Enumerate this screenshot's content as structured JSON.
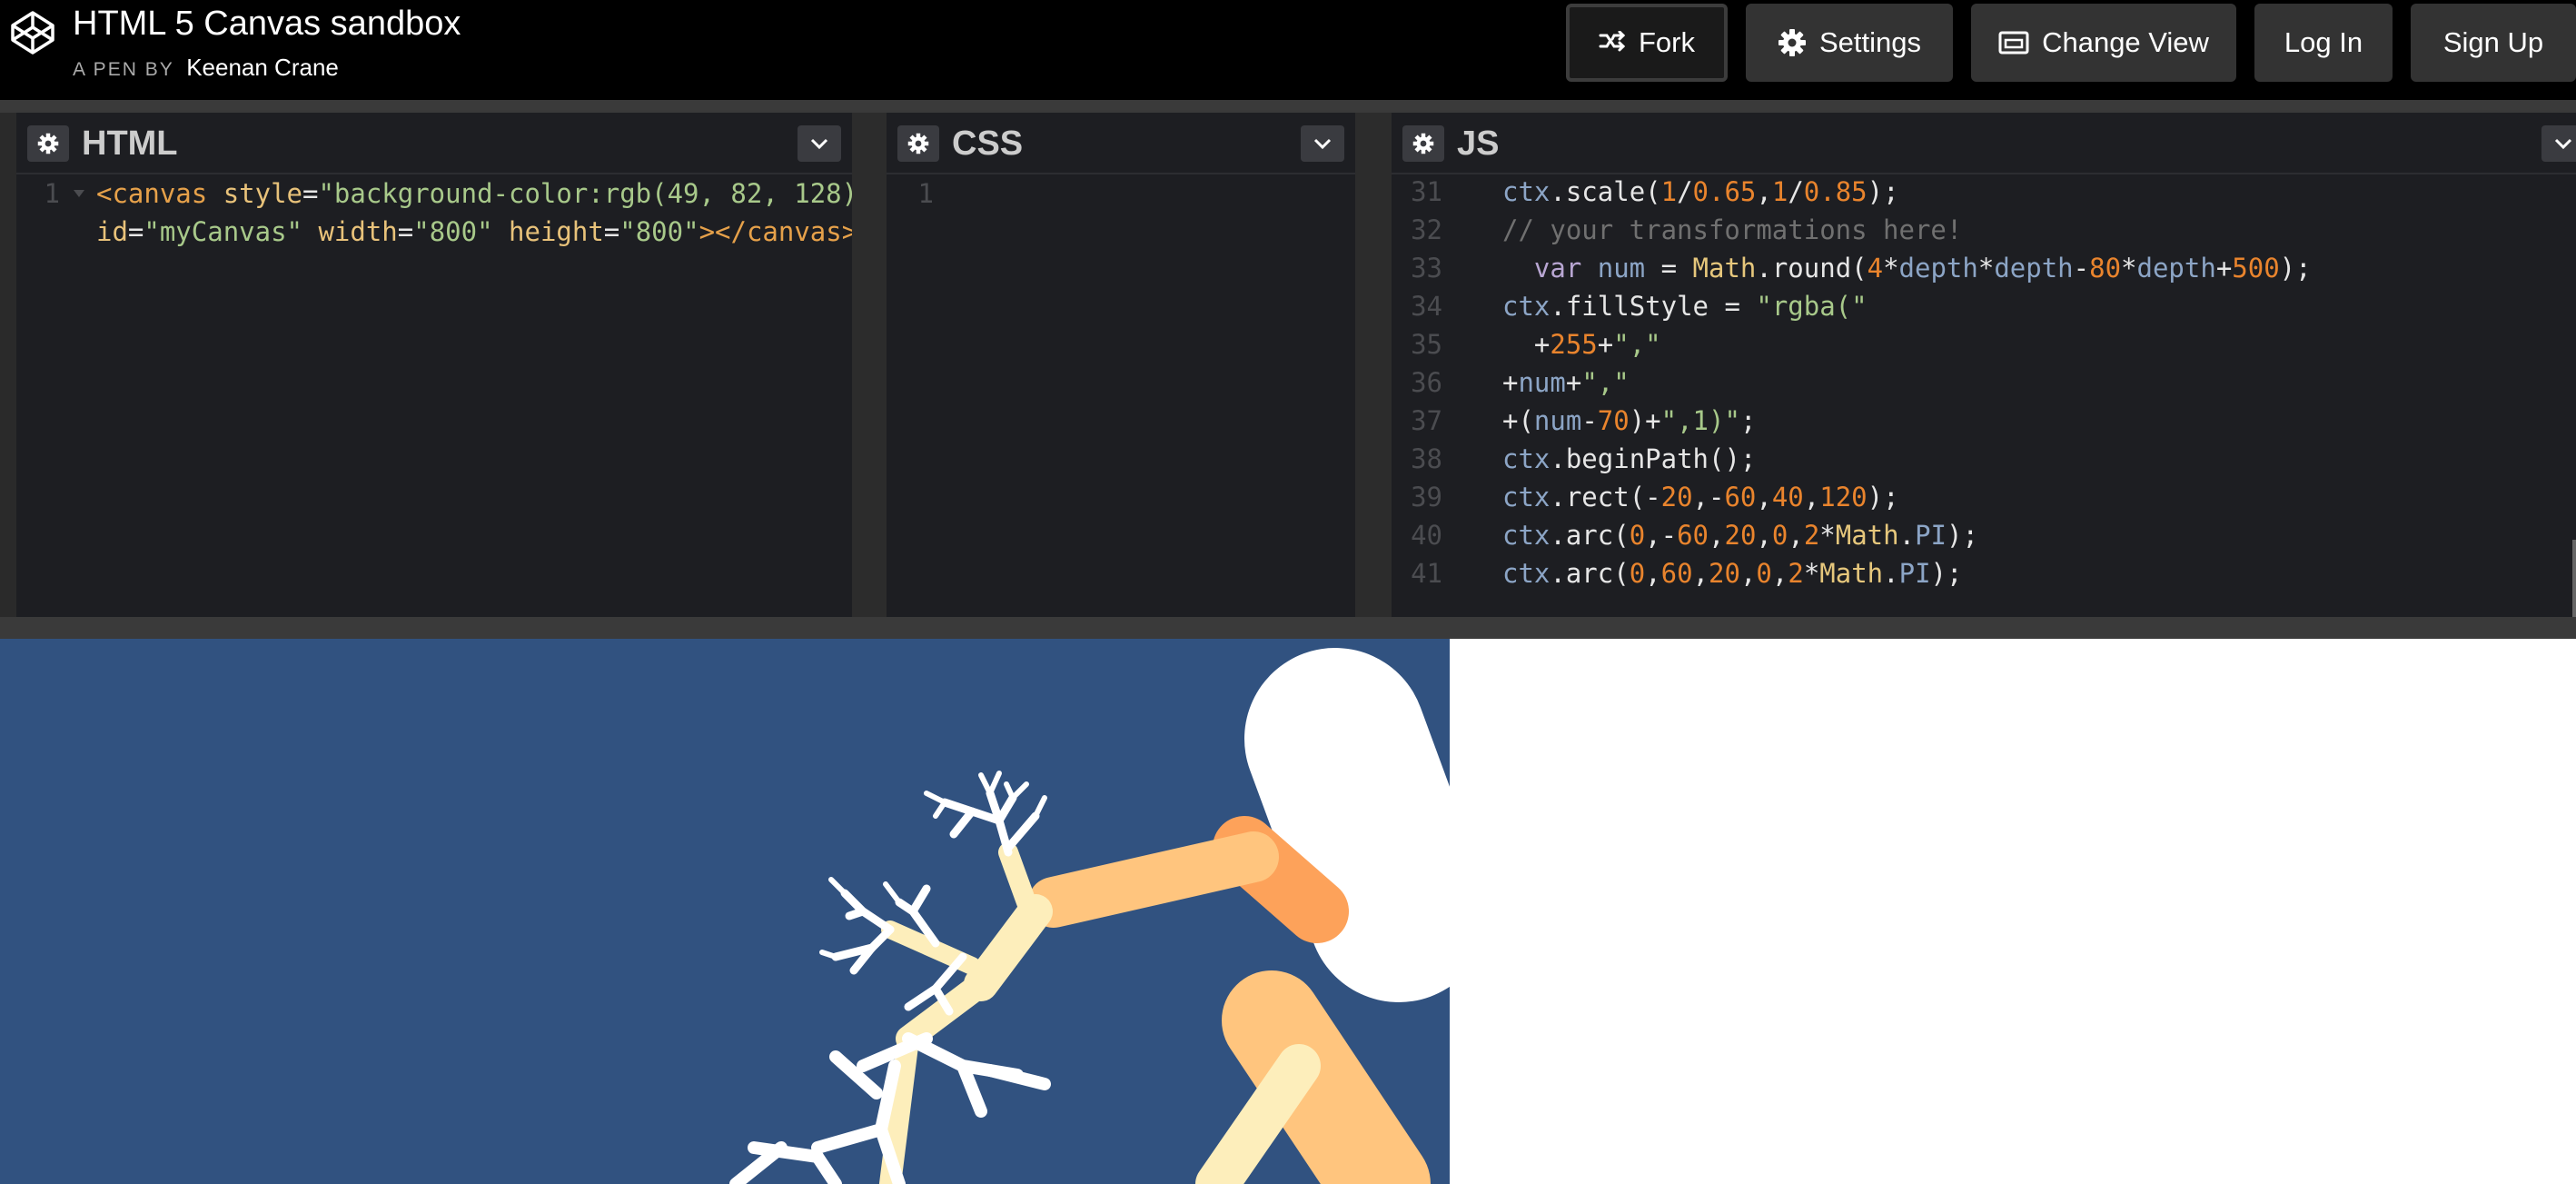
{
  "header": {
    "title": "HTML 5 Canvas sandbox",
    "byline_prefix": "A PEN BY",
    "author": "Keenan Crane",
    "buttons": {
      "fork": "Fork",
      "settings": "Settings",
      "change_view": "Change View",
      "login": "Log In",
      "signup": "Sign Up"
    }
  },
  "panes": {
    "html": {
      "title": "HTML"
    },
    "css": {
      "title": "CSS",
      "line_number": "1"
    },
    "js": {
      "title": "JS"
    }
  },
  "html_code": {
    "line_number": "1",
    "line1": [
      {
        "t": "<canvas ",
        "c": "tag"
      },
      {
        "t": "style",
        "c": "attr"
      },
      {
        "t": "=",
        "c": "pl"
      },
      {
        "t": "\"background-color:rgb(49, 82, 128)\"",
        "c": "str"
      }
    ],
    "line2": [
      {
        "t": "id",
        "c": "attr"
      },
      {
        "t": "=",
        "c": "pl"
      },
      {
        "t": "\"myCanvas\"",
        "c": "str"
      },
      {
        "t": " ",
        "c": "pl"
      },
      {
        "t": "width",
        "c": "attr"
      },
      {
        "t": "=",
        "c": "pl"
      },
      {
        "t": "\"800\"",
        "c": "str"
      },
      {
        "t": " ",
        "c": "pl"
      },
      {
        "t": "height",
        "c": "attr"
      },
      {
        "t": "=",
        "c": "pl"
      },
      {
        "t": "\"800\"",
        "c": "str"
      },
      {
        "t": "></canvas>",
        "c": "tag"
      }
    ]
  },
  "js_code": [
    {
      "n": "31",
      "indent": "",
      "toks": [
        {
          "t": "ctx",
          "c": "prop"
        },
        {
          "t": ".scale(",
          "c": "pl"
        },
        {
          "t": "1",
          "c": "num"
        },
        {
          "t": "/",
          "c": "pl"
        },
        {
          "t": "0.65",
          "c": "num"
        },
        {
          "t": ",",
          "c": "pl"
        },
        {
          "t": "1",
          "c": "num"
        },
        {
          "t": "/",
          "c": "pl"
        },
        {
          "t": "0.85",
          "c": "num"
        },
        {
          "t": ");",
          "c": "pl"
        }
      ]
    },
    {
      "n": "32",
      "indent": "",
      "toks": [
        {
          "t": "// your transformations here!",
          "c": "cm"
        }
      ]
    },
    {
      "n": "33",
      "indent": "  ",
      "toks": [
        {
          "t": "var ",
          "c": "kw"
        },
        {
          "t": "num",
          "c": "prop"
        },
        {
          "t": " = ",
          "c": "pl"
        },
        {
          "t": "Math",
          "c": "fn"
        },
        {
          "t": ".round(",
          "c": "pl"
        },
        {
          "t": "4",
          "c": "num"
        },
        {
          "t": "*",
          "c": "pl"
        },
        {
          "t": "depth",
          "c": "prop"
        },
        {
          "t": "*",
          "c": "pl"
        },
        {
          "t": "depth",
          "c": "prop"
        },
        {
          "t": "-",
          "c": "pl"
        },
        {
          "t": "80",
          "c": "num"
        },
        {
          "t": "*",
          "c": "pl"
        },
        {
          "t": "depth",
          "c": "prop"
        },
        {
          "t": "+",
          "c": "pl"
        },
        {
          "t": "500",
          "c": "num"
        },
        {
          "t": ");",
          "c": "pl"
        }
      ]
    },
    {
      "n": "34",
      "indent": "",
      "toks": [
        {
          "t": "ctx",
          "c": "prop"
        },
        {
          "t": ".fillStyle = ",
          "c": "pl"
        },
        {
          "t": "\"rgba(\"",
          "c": "str"
        }
      ]
    },
    {
      "n": "35",
      "indent": "  ",
      "toks": [
        {
          "t": "+",
          "c": "pl"
        },
        {
          "t": "255",
          "c": "num"
        },
        {
          "t": "+",
          "c": "pl"
        },
        {
          "t": "\",\"",
          "c": "str"
        }
      ]
    },
    {
      "n": "36",
      "indent": "",
      "toks": [
        {
          "t": "+",
          "c": "pl"
        },
        {
          "t": "num",
          "c": "prop"
        },
        {
          "t": "+",
          "c": "pl"
        },
        {
          "t": "\",\"",
          "c": "str"
        }
      ]
    },
    {
      "n": "37",
      "indent": "",
      "toks": [
        {
          "t": "+(",
          "c": "pl"
        },
        {
          "t": "num",
          "c": "prop"
        },
        {
          "t": "-",
          "c": "pl"
        },
        {
          "t": "70",
          "c": "num"
        },
        {
          "t": ")+",
          "c": "pl"
        },
        {
          "t": "\",1)\"",
          "c": "str"
        },
        {
          "t": ";",
          "c": "pl"
        }
      ]
    },
    {
      "n": "38",
      "indent": "",
      "toks": [
        {
          "t": "ctx",
          "c": "prop"
        },
        {
          "t": ".beginPath();",
          "c": "pl"
        }
      ]
    },
    {
      "n": "39",
      "indent": "",
      "toks": [
        {
          "t": "ctx",
          "c": "prop"
        },
        {
          "t": ".rect(-",
          "c": "pl"
        },
        {
          "t": "20",
          "c": "num"
        },
        {
          "t": ",-",
          "c": "pl"
        },
        {
          "t": "60",
          "c": "num"
        },
        {
          "t": ",",
          "c": "pl"
        },
        {
          "t": "40",
          "c": "num"
        },
        {
          "t": ",",
          "c": "pl"
        },
        {
          "t": "120",
          "c": "num"
        },
        {
          "t": ");",
          "c": "pl"
        }
      ]
    },
    {
      "n": "40",
      "indent": "",
      "toks": [
        {
          "t": "ctx",
          "c": "prop"
        },
        {
          "t": ".arc(",
          "c": "pl"
        },
        {
          "t": "0",
          "c": "num"
        },
        {
          "t": ",-",
          "c": "pl"
        },
        {
          "t": "60",
          "c": "num"
        },
        {
          "t": ",",
          "c": "pl"
        },
        {
          "t": "20",
          "c": "num"
        },
        {
          "t": ",",
          "c": "pl"
        },
        {
          "t": "0",
          "c": "num"
        },
        {
          "t": ",",
          "c": "pl"
        },
        {
          "t": "2",
          "c": "num"
        },
        {
          "t": "*",
          "c": "pl"
        },
        {
          "t": "Math",
          "c": "fn"
        },
        {
          "t": ".",
          "c": "pl"
        },
        {
          "t": "PI",
          "c": "prop"
        },
        {
          "t": ");",
          "c": "pl"
        }
      ]
    },
    {
      "n": "41",
      "indent": "",
      "toks": [
        {
          "t": "ctx",
          "c": "prop"
        },
        {
          "t": ".arc(",
          "c": "pl"
        },
        {
          "t": "0",
          "c": "num"
        },
        {
          "t": ",",
          "c": "pl"
        },
        {
          "t": "60",
          "c": "num"
        },
        {
          "t": ",",
          "c": "pl"
        },
        {
          "t": "20",
          "c": "num"
        },
        {
          "t": ",",
          "c": "pl"
        },
        {
          "t": "0",
          "c": "num"
        },
        {
          "t": ",",
          "c": "pl"
        },
        {
          "t": "2",
          "c": "num"
        },
        {
          "t": "*",
          "c": "pl"
        },
        {
          "t": "Math",
          "c": "fn"
        },
        {
          "t": ".",
          "c": "pl"
        },
        {
          "t": "PI",
          "c": "prop"
        },
        {
          "t": ");",
          "c": "pl"
        }
      ]
    }
  ],
  "colors": {
    "canvas_bg": "#315280",
    "branch_light": "#fdeebb",
    "branch_mid": "#ffc57e",
    "branch_dark": "#fda25a"
  }
}
